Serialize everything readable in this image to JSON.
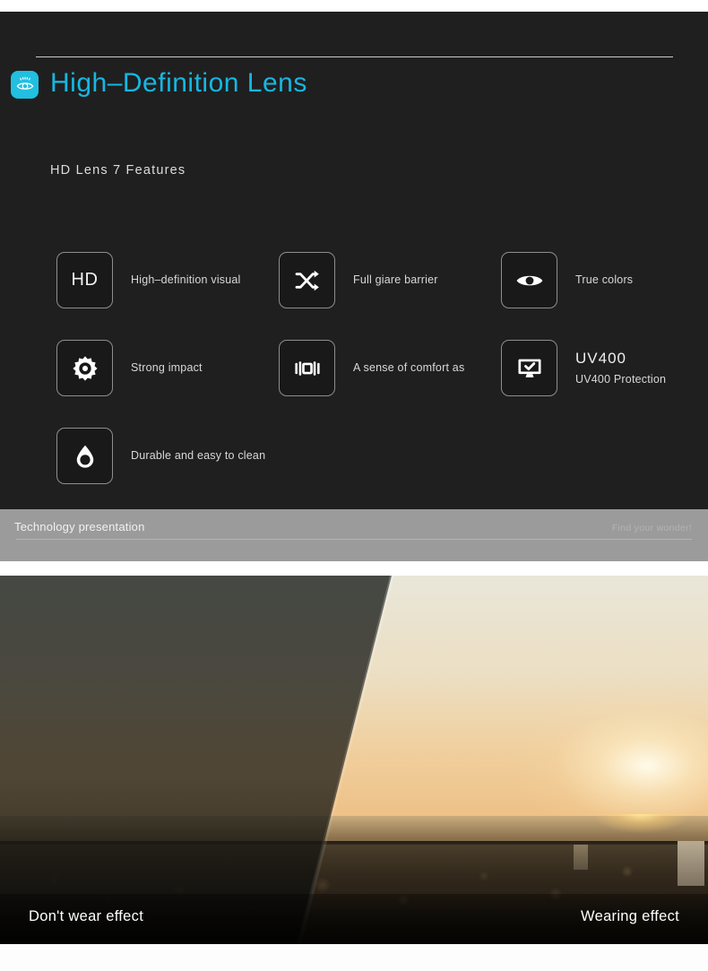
{
  "header": {
    "brand_icon": "eye-icon",
    "title": "High–Definition Lens",
    "accent_color": "#16b7e2",
    "icon_bg_color": "#21bfe0"
  },
  "subtitle": "HD Lens 7 Features",
  "features": [
    {
      "icon": "hd-text-icon",
      "icon_text": "HD",
      "label": "High–definition visual"
    },
    {
      "icon": "shuffle-arrows-icon",
      "icon_text": "",
      "label": "Full giare barrier"
    },
    {
      "icon": "eye-icon",
      "icon_text": "",
      "label": "True colors"
    },
    {
      "icon": "gear-icon",
      "icon_text": "",
      "label": "Strong impact"
    },
    {
      "icon": "sound-bars-icon",
      "icon_text": "",
      "label": "A sense of comfort as"
    },
    {
      "icon": "monitor-check-icon",
      "icon_text": "",
      "label_primary": "UV400",
      "label_secondary": "UV400 Protection"
    },
    {
      "icon": "water-drop-icon",
      "icon_text": "",
      "label": "Durable and easy to clean"
    }
  ],
  "footer_bar": {
    "left_label": "Technology presentation",
    "right_label": "Find your wonder!",
    "background_color": "#9b9b9b"
  },
  "photo": {
    "caption_left": "Don't wear effect",
    "caption_right": "Wearing effect"
  }
}
